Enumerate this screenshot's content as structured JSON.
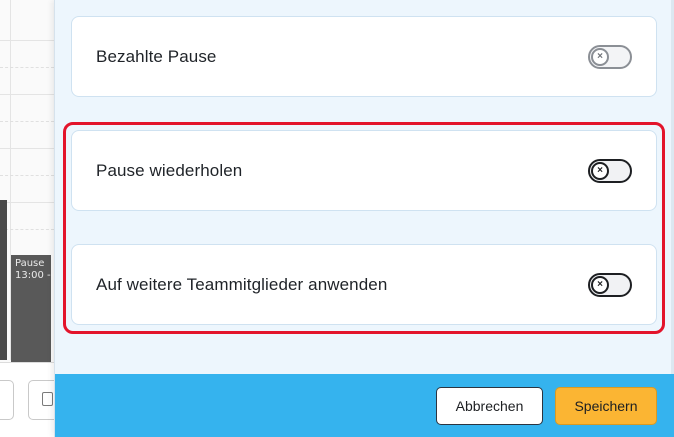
{
  "background_calendar": {
    "event_title": "Pause",
    "event_time": "13:00 -"
  },
  "settings": {
    "items": [
      {
        "label": "Bezahlte Pause",
        "toggle_state": "off",
        "toggle_icon": "close-icon"
      },
      {
        "label": "Pause wiederholen",
        "toggle_state": "off",
        "toggle_icon": "close-icon"
      },
      {
        "label": "Auf weitere Teammitglieder anwenden",
        "toggle_state": "off",
        "toggle_icon": "close-icon"
      }
    ],
    "toggle_glyph": "×"
  },
  "footer": {
    "cancel_label": "Abbrechen",
    "save_label": "Speichern"
  },
  "colors": {
    "highlight": "#e3142b",
    "footer_bg": "#35b3ee",
    "save_button": "#fbb533",
    "panel_bg": "#edf6fd"
  }
}
